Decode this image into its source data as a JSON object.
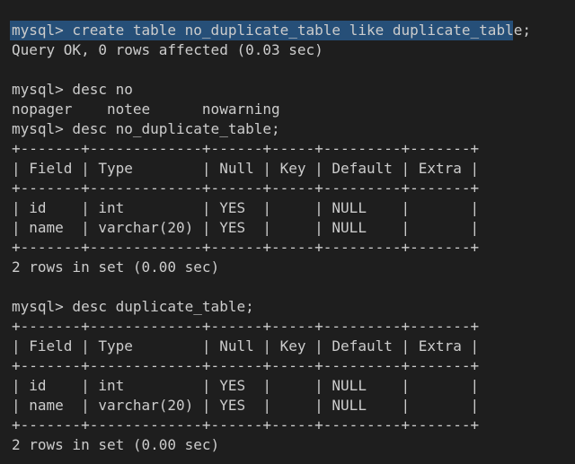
{
  "terminal": {
    "lines": [
      "mysql> create table no_duplicate_table like duplicate_table;",
      "Query OK, 0 rows affected (0.03 sec)",
      "",
      "mysql> desc no",
      "nopager    notee      nowarning",
      "mysql> desc no_duplicate_table;",
      "+-------+-------------+------+-----+---------+-------+",
      "| Field | Type        | Null | Key | Default | Extra |",
      "+-------+-------------+------+-----+---------+-------+",
      "| id    | int         | YES  |     | NULL    |       |",
      "| name  | varchar(20) | YES  |     | NULL    |       |",
      "+-------+-------------+------+-----+---------+-------+",
      "2 rows in set (0.00 sec)",
      "",
      "mysql> desc duplicate_table;",
      "+-------+-------------+------+-----+---------+-------+",
      "| Field | Type        | Null | Key | Default | Extra |",
      "+-------+-------------+------+-----+---------+-------+",
      "| id    | int         | YES  |     | NULL    |       |",
      "| name  | varchar(20) | YES  |     | NULL    |       |",
      "+-------+-------------+------+-----+---------+-------+",
      "2 rows in set (0.00 sec)"
    ],
    "colors": {
      "background": "#1e1e1e",
      "text": "#cccccc",
      "selection": "#264f78"
    }
  }
}
